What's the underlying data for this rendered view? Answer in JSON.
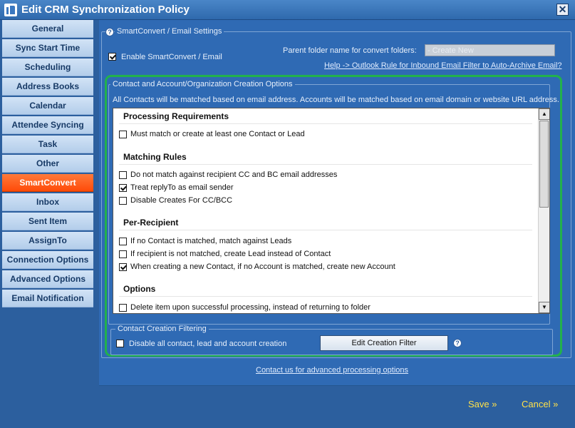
{
  "window": {
    "title": "Edit CRM Synchronization Policy",
    "close_glyph": "✕"
  },
  "sidebar": {
    "items": [
      {
        "label": "General"
      },
      {
        "label": "Sync Start Time"
      },
      {
        "label": "Scheduling"
      },
      {
        "label": "Address Books"
      },
      {
        "label": "Calendar"
      },
      {
        "label": "Attendee Syncing"
      },
      {
        "label": "Task"
      },
      {
        "label": "Other"
      },
      {
        "label": "SmartConvert",
        "active": true
      },
      {
        "label": "Inbox"
      },
      {
        "label": "Sent Item"
      },
      {
        "label": "AssignTo"
      },
      {
        "label": "Connection Options"
      },
      {
        "label": "Advanced Options"
      },
      {
        "label": "Email Notification"
      }
    ]
  },
  "smartconvert": {
    "group_title": "SmartConvert / Email Settings",
    "enable_label": "Enable SmartConvert / Email",
    "enable_checked": true,
    "parent_folder_label": "Parent folder name for convert folders:",
    "parent_folder_value": "- Create New",
    "help_link": "Help -> Outlook Rule for Inbound Email Filter to Auto-Archive Email?"
  },
  "creation": {
    "group_title": "Contact and Account/Organization Creation Options",
    "description": "All Contacts will be matched based on email address.  Accounts will be matched based on email domain or website URL address.",
    "sections": {
      "processing": {
        "heading": "Processing Requirements",
        "options": [
          {
            "label": "Must match or create at least one Contact or Lead",
            "checked": false
          }
        ]
      },
      "matching": {
        "heading": "Matching Rules",
        "options": [
          {
            "label": "Do not match against recipient CC and BC email addresses",
            "checked": false
          },
          {
            "label": "Treat replyTo as email sender",
            "checked": true
          },
          {
            "label": "Disable Creates For CC/BCC",
            "checked": false
          }
        ]
      },
      "per_recipient": {
        "heading": "Per-Recipient",
        "options": [
          {
            "label": "If no Contact is matched, match against Leads",
            "checked": false
          },
          {
            "label": "If recipient is not matched, create Lead instead of Contact",
            "checked": false
          },
          {
            "label": "When creating a new Contact, if no Account is matched, create new Account",
            "checked": true
          }
        ]
      },
      "options": {
        "heading": "Options",
        "options": [
          {
            "label": "Delete item upon successful processing, instead of returning to folder",
            "checked": false
          }
        ]
      }
    }
  },
  "filtering": {
    "group_title": "Contact Creation Filtering",
    "disable_label": "Disable all contact, lead and account creation",
    "disable_checked": false,
    "edit_button": "Edit Creation Filter"
  },
  "footer": {
    "contact_link": "Contact us for advanced processing options",
    "save": "Save »",
    "cancel": "Cancel »"
  },
  "colors": {
    "background": "#2c5f9e",
    "active_tab": "#ff4a08",
    "highlight_outline": "#22b14c",
    "footer_link": "#ffe14a"
  },
  "icons": {
    "help": "question-circle-icon",
    "check": "checkmark-icon",
    "scroll_up": "arrow-up-icon",
    "scroll_down": "arrow-down-icon",
    "logo": "app-logo-icon"
  }
}
